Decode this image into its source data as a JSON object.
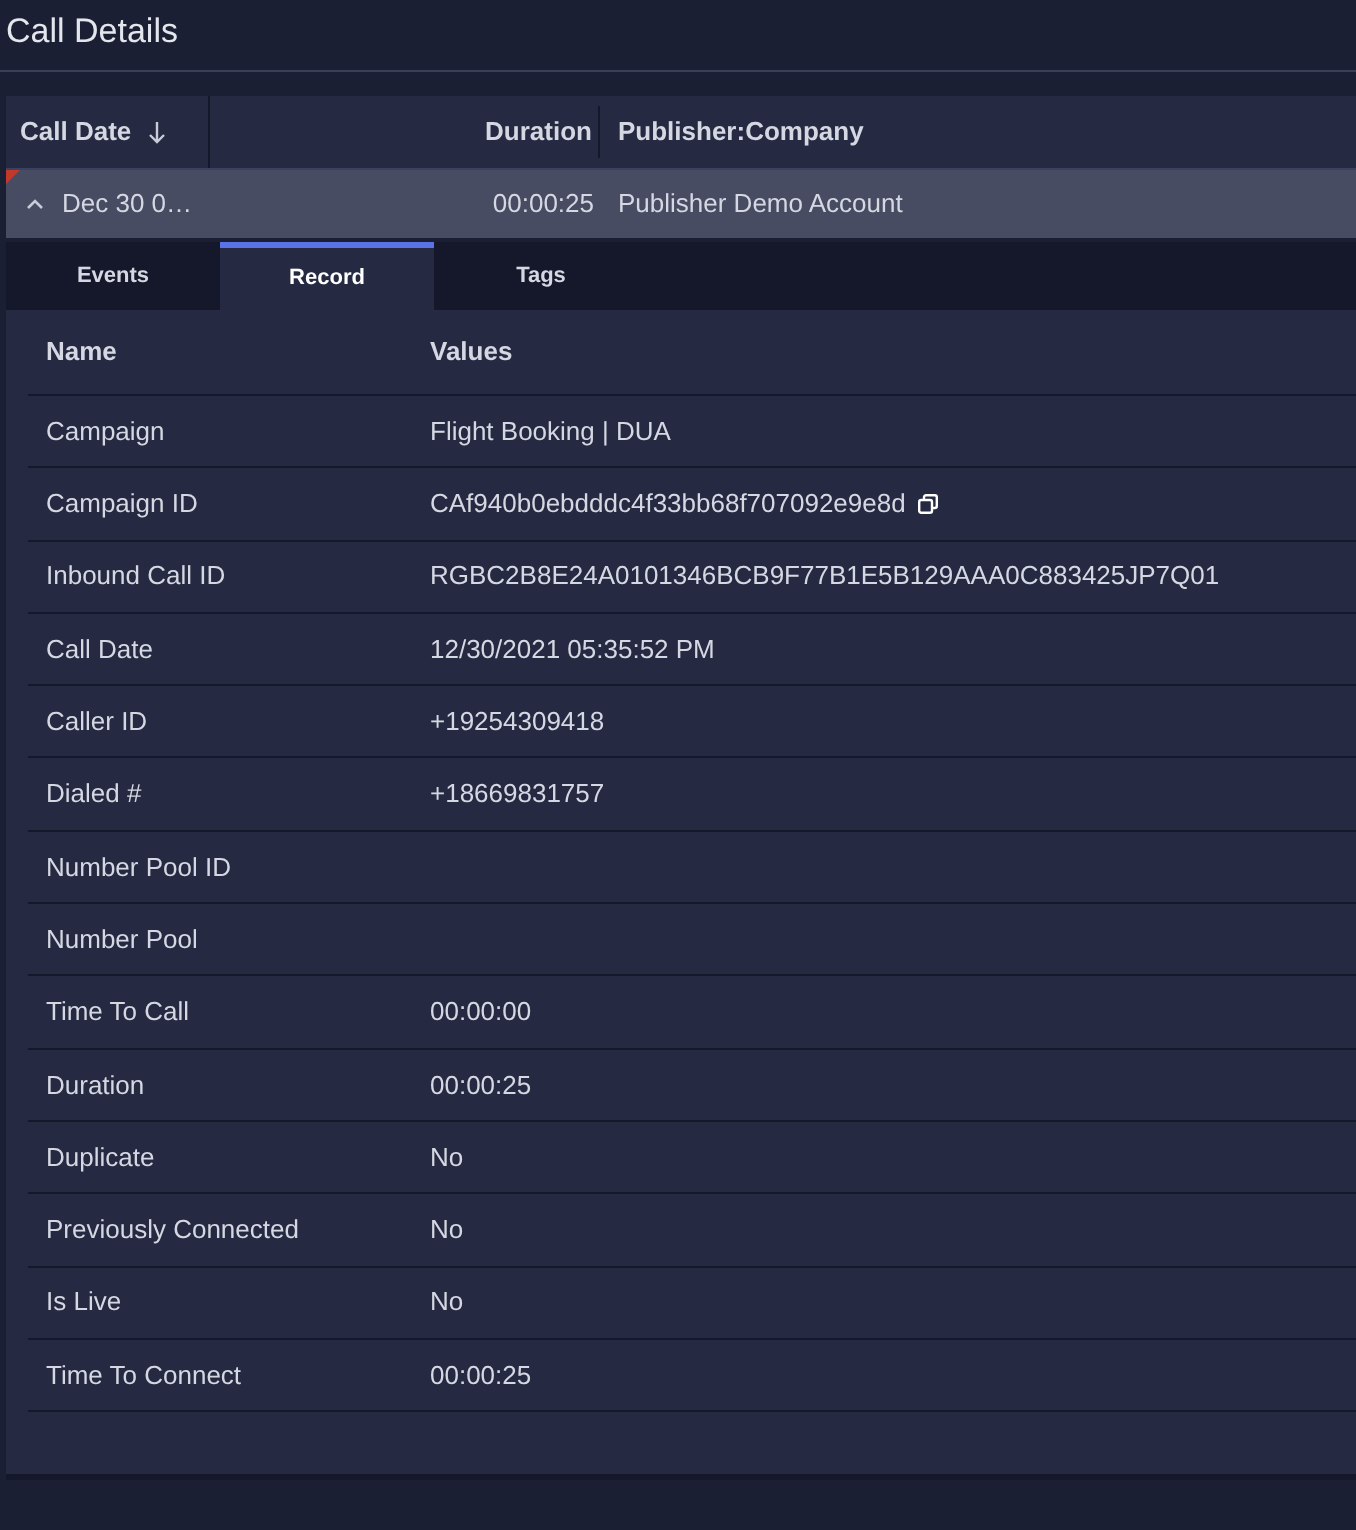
{
  "title": "Call Details",
  "columns": [
    {
      "label": "Call Date",
      "sorted_descending": true
    },
    {
      "label": "Duration"
    },
    {
      "label": "Publisher:Company"
    }
  ],
  "rows": [
    {
      "expanded": true,
      "selected": true,
      "call_date": "Dec 30 0…",
      "duration": "00:00:25",
      "publisher": "Publisher Demo Account"
    }
  ],
  "tabs": [
    {
      "label": "Events",
      "selected": false
    },
    {
      "label": "Record",
      "selected": true
    },
    {
      "label": "Tags",
      "selected": false
    }
  ],
  "record": {
    "columns": [
      "Name",
      "Values"
    ],
    "fields": [
      {
        "name": "Campaign",
        "value": "Flight Booking | DUA"
      },
      {
        "name": "Campaign ID",
        "value": "CAf940b0ebdddc4f33bb68f707092e9e8d",
        "copyable": true
      },
      {
        "name": "Inbound Call ID",
        "value": "RGBC2B8E24A0101346BCB9F77B1E5B129AAA0C883425JP7Q01"
      },
      {
        "name": "Call Date",
        "value": "12/30/2021 05:35:52 PM"
      },
      {
        "name": "Caller ID",
        "value": "+19254309418"
      },
      {
        "name": "Dialed #",
        "value": "+18669831757"
      },
      {
        "name": "Number Pool ID"
      },
      {
        "name": "Number Pool"
      },
      {
        "name": "Time To Call",
        "value": "00:00:00"
      },
      {
        "name": "Duration",
        "value": "00:00:25"
      },
      {
        "name": "Duplicate",
        "value": "No"
      },
      {
        "name": "Previously Connected",
        "value": "No"
      },
      {
        "name": "Is Live",
        "value": "No"
      },
      {
        "name": "Time To Connect",
        "value": "00:00:25"
      }
    ]
  }
}
